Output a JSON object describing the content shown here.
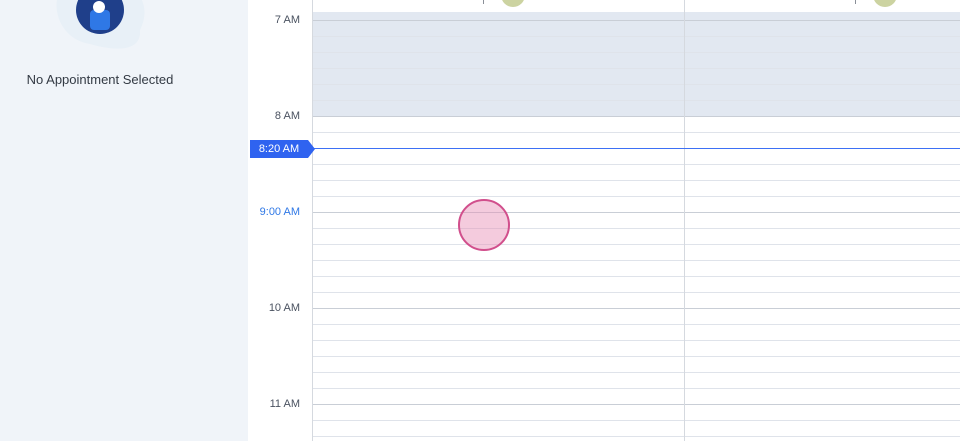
{
  "sidebar": {
    "empty_state_text": "No Appointment Selected"
  },
  "calendar": {
    "time_labels": [
      "7 AM",
      "8 AM",
      "9:00 AM",
      "10 AM",
      "11 AM"
    ],
    "current_time": "8:20 AM",
    "colors": {
      "now_indicator": "#2f63f0",
      "blocked_time": "#e2e8f1",
      "hover_time": "#2f78e6"
    }
  }
}
